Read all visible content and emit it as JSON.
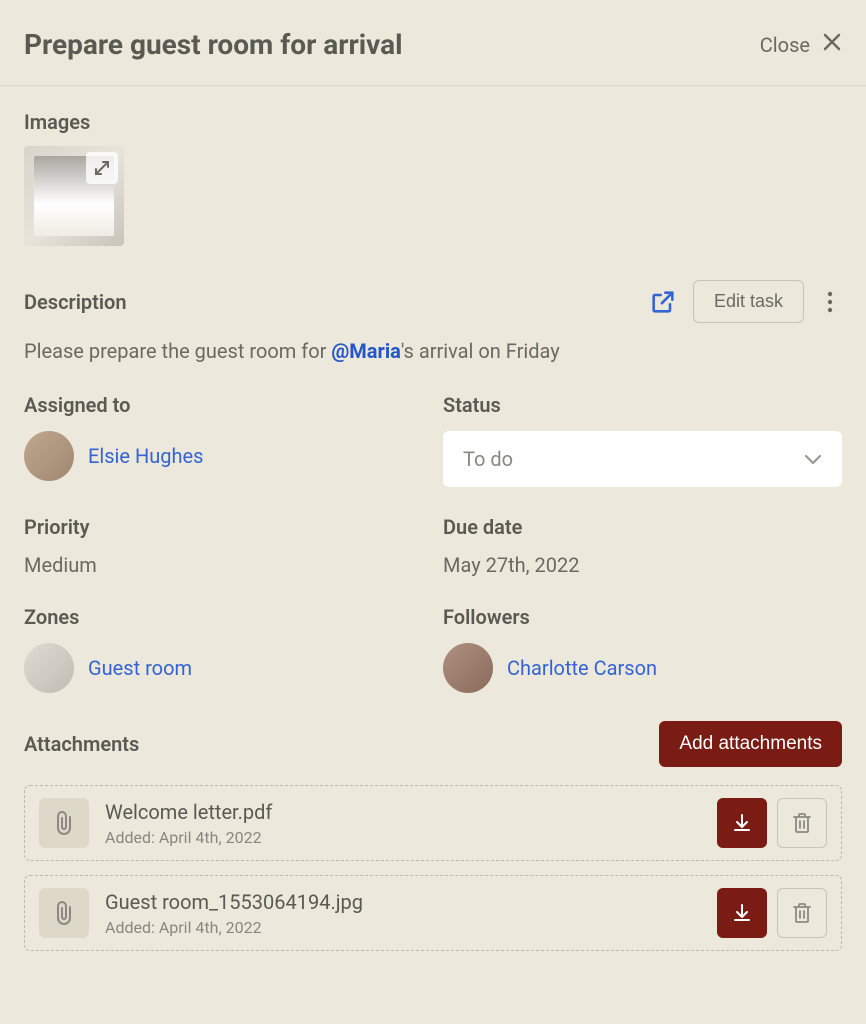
{
  "header": {
    "title": "Prepare guest room for arrival",
    "close_label": "Close"
  },
  "sections": {
    "images": {
      "label": "Images"
    },
    "description": {
      "label": "Description",
      "text_before": "Please prepare the guest room for ",
      "mention": "@Maria",
      "text_after": "'s arrival on Friday",
      "edit_label": "Edit task"
    },
    "assigned": {
      "label": "Assigned to",
      "name": "Elsie Hughes"
    },
    "status": {
      "label": "Status",
      "value": "To do"
    },
    "priority": {
      "label": "Priority",
      "value": "Medium"
    },
    "due_date": {
      "label": "Due date",
      "value": "May 27th, 2022"
    },
    "zones": {
      "label": "Zones",
      "name": "Guest room"
    },
    "followers": {
      "label": "Followers",
      "name": "Charlotte Carson"
    },
    "attachments": {
      "label": "Attachments",
      "add_label": "Add attachments",
      "items": [
        {
          "name": "Welcome letter.pdf",
          "meta": "Added: April 4th, 2022"
        },
        {
          "name": "Guest room_1553064194.jpg",
          "meta": "Added: April 4th, 2022"
        }
      ]
    }
  }
}
